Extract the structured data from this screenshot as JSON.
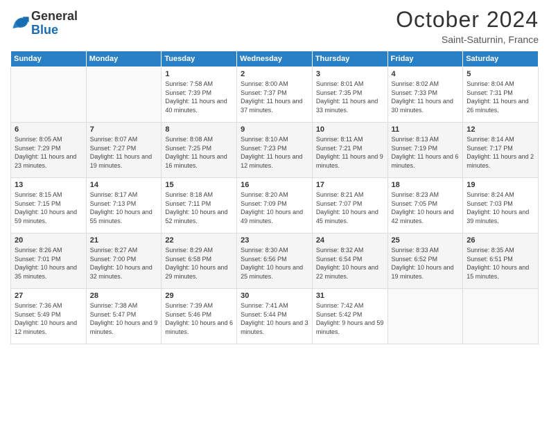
{
  "logo": {
    "general": "General",
    "blue": "Blue"
  },
  "header": {
    "title": "October 2024",
    "location": "Saint-Saturnin, France"
  },
  "weekdays": [
    "Sunday",
    "Monday",
    "Tuesday",
    "Wednesday",
    "Thursday",
    "Friday",
    "Saturday"
  ],
  "weeks": [
    [
      {
        "day": "",
        "sunrise": "",
        "sunset": "",
        "daylight": ""
      },
      {
        "day": "",
        "sunrise": "",
        "sunset": "",
        "daylight": ""
      },
      {
        "day": "1",
        "sunrise": "Sunrise: 7:58 AM",
        "sunset": "Sunset: 7:39 PM",
        "daylight": "Daylight: 11 hours and 40 minutes."
      },
      {
        "day": "2",
        "sunrise": "Sunrise: 8:00 AM",
        "sunset": "Sunset: 7:37 PM",
        "daylight": "Daylight: 11 hours and 37 minutes."
      },
      {
        "day": "3",
        "sunrise": "Sunrise: 8:01 AM",
        "sunset": "Sunset: 7:35 PM",
        "daylight": "Daylight: 11 hours and 33 minutes."
      },
      {
        "day": "4",
        "sunrise": "Sunrise: 8:02 AM",
        "sunset": "Sunset: 7:33 PM",
        "daylight": "Daylight: 11 hours and 30 minutes."
      },
      {
        "day": "5",
        "sunrise": "Sunrise: 8:04 AM",
        "sunset": "Sunset: 7:31 PM",
        "daylight": "Daylight: 11 hours and 26 minutes."
      }
    ],
    [
      {
        "day": "6",
        "sunrise": "Sunrise: 8:05 AM",
        "sunset": "Sunset: 7:29 PM",
        "daylight": "Daylight: 11 hours and 23 minutes."
      },
      {
        "day": "7",
        "sunrise": "Sunrise: 8:07 AM",
        "sunset": "Sunset: 7:27 PM",
        "daylight": "Daylight: 11 hours and 19 minutes."
      },
      {
        "day": "8",
        "sunrise": "Sunrise: 8:08 AM",
        "sunset": "Sunset: 7:25 PM",
        "daylight": "Daylight: 11 hours and 16 minutes."
      },
      {
        "day": "9",
        "sunrise": "Sunrise: 8:10 AM",
        "sunset": "Sunset: 7:23 PM",
        "daylight": "Daylight: 11 hours and 12 minutes."
      },
      {
        "day": "10",
        "sunrise": "Sunrise: 8:11 AM",
        "sunset": "Sunset: 7:21 PM",
        "daylight": "Daylight: 11 hours and 9 minutes."
      },
      {
        "day": "11",
        "sunrise": "Sunrise: 8:13 AM",
        "sunset": "Sunset: 7:19 PM",
        "daylight": "Daylight: 11 hours and 6 minutes."
      },
      {
        "day": "12",
        "sunrise": "Sunrise: 8:14 AM",
        "sunset": "Sunset: 7:17 PM",
        "daylight": "Daylight: 11 hours and 2 minutes."
      }
    ],
    [
      {
        "day": "13",
        "sunrise": "Sunrise: 8:15 AM",
        "sunset": "Sunset: 7:15 PM",
        "daylight": "Daylight: 10 hours and 59 minutes."
      },
      {
        "day": "14",
        "sunrise": "Sunrise: 8:17 AM",
        "sunset": "Sunset: 7:13 PM",
        "daylight": "Daylight: 10 hours and 55 minutes."
      },
      {
        "day": "15",
        "sunrise": "Sunrise: 8:18 AM",
        "sunset": "Sunset: 7:11 PM",
        "daylight": "Daylight: 10 hours and 52 minutes."
      },
      {
        "day": "16",
        "sunrise": "Sunrise: 8:20 AM",
        "sunset": "Sunset: 7:09 PM",
        "daylight": "Daylight: 10 hours and 49 minutes."
      },
      {
        "day": "17",
        "sunrise": "Sunrise: 8:21 AM",
        "sunset": "Sunset: 7:07 PM",
        "daylight": "Daylight: 10 hours and 45 minutes."
      },
      {
        "day": "18",
        "sunrise": "Sunrise: 8:23 AM",
        "sunset": "Sunset: 7:05 PM",
        "daylight": "Daylight: 10 hours and 42 minutes."
      },
      {
        "day": "19",
        "sunrise": "Sunrise: 8:24 AM",
        "sunset": "Sunset: 7:03 PM",
        "daylight": "Daylight: 10 hours and 39 minutes."
      }
    ],
    [
      {
        "day": "20",
        "sunrise": "Sunrise: 8:26 AM",
        "sunset": "Sunset: 7:01 PM",
        "daylight": "Daylight: 10 hours and 35 minutes."
      },
      {
        "day": "21",
        "sunrise": "Sunrise: 8:27 AM",
        "sunset": "Sunset: 7:00 PM",
        "daylight": "Daylight: 10 hours and 32 minutes."
      },
      {
        "day": "22",
        "sunrise": "Sunrise: 8:29 AM",
        "sunset": "Sunset: 6:58 PM",
        "daylight": "Daylight: 10 hours and 29 minutes."
      },
      {
        "day": "23",
        "sunrise": "Sunrise: 8:30 AM",
        "sunset": "Sunset: 6:56 PM",
        "daylight": "Daylight: 10 hours and 25 minutes."
      },
      {
        "day": "24",
        "sunrise": "Sunrise: 8:32 AM",
        "sunset": "Sunset: 6:54 PM",
        "daylight": "Daylight: 10 hours and 22 minutes."
      },
      {
        "day": "25",
        "sunrise": "Sunrise: 8:33 AM",
        "sunset": "Sunset: 6:52 PM",
        "daylight": "Daylight: 10 hours and 19 minutes."
      },
      {
        "day": "26",
        "sunrise": "Sunrise: 8:35 AM",
        "sunset": "Sunset: 6:51 PM",
        "daylight": "Daylight: 10 hours and 15 minutes."
      }
    ],
    [
      {
        "day": "27",
        "sunrise": "Sunrise: 7:36 AM",
        "sunset": "Sunset: 5:49 PM",
        "daylight": "Daylight: 10 hours and 12 minutes."
      },
      {
        "day": "28",
        "sunrise": "Sunrise: 7:38 AM",
        "sunset": "Sunset: 5:47 PM",
        "daylight": "Daylight: 10 hours and 9 minutes."
      },
      {
        "day": "29",
        "sunrise": "Sunrise: 7:39 AM",
        "sunset": "Sunset: 5:46 PM",
        "daylight": "Daylight: 10 hours and 6 minutes."
      },
      {
        "day": "30",
        "sunrise": "Sunrise: 7:41 AM",
        "sunset": "Sunset: 5:44 PM",
        "daylight": "Daylight: 10 hours and 3 minutes."
      },
      {
        "day": "31",
        "sunrise": "Sunrise: 7:42 AM",
        "sunset": "Sunset: 5:42 PM",
        "daylight": "Daylight: 9 hours and 59 minutes."
      },
      {
        "day": "",
        "sunrise": "",
        "sunset": "",
        "daylight": ""
      },
      {
        "day": "",
        "sunrise": "",
        "sunset": "",
        "daylight": ""
      }
    ]
  ]
}
